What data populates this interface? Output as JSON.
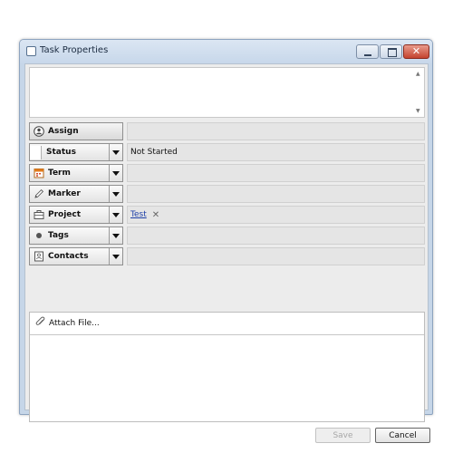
{
  "window": {
    "title": "Task Properties",
    "close_glyph": "✕"
  },
  "notes": {
    "value": "",
    "scroll_up": "▲",
    "scroll_down": "▼"
  },
  "fields": [
    {
      "id": "assign",
      "label": "Assign",
      "icon": "person-icon",
      "has_dropdown": false,
      "value": ""
    },
    {
      "id": "status",
      "label": "Status",
      "icon": "blank-box",
      "has_dropdown": true,
      "value": "Not Started"
    },
    {
      "id": "term",
      "label": "Term",
      "icon": "calendar-icon",
      "has_dropdown": true,
      "value": ""
    },
    {
      "id": "marker",
      "label": "Marker",
      "icon": "pencil-icon",
      "has_dropdown": true,
      "value": ""
    },
    {
      "id": "project",
      "label": "Project",
      "icon": "briefcase-icon",
      "has_dropdown": true,
      "value": "Test",
      "remove_glyph": "✕"
    },
    {
      "id": "tags",
      "label": "Tags",
      "icon": "dot-icon",
      "has_dropdown": true,
      "value": ""
    },
    {
      "id": "contacts",
      "label": "Contacts",
      "icon": "contact-card-icon",
      "has_dropdown": true,
      "value": ""
    }
  ],
  "attachments": {
    "label": "Attach File...",
    "icon": "paperclip-icon"
  },
  "footer": {
    "save_label": "Save",
    "cancel_label": "Cancel"
  },
  "colors": {
    "accent_close": "#c4432e",
    "calendar": "#e07a1a",
    "link": "#1d3fa8"
  }
}
